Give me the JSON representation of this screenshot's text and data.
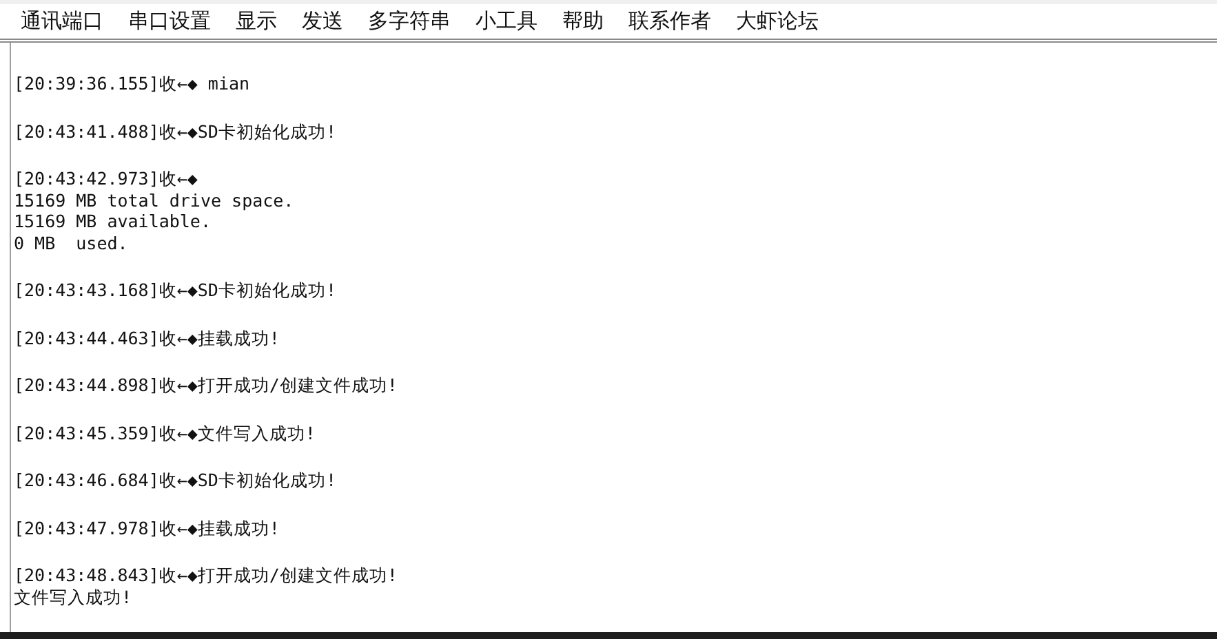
{
  "menu": [
    "通讯端口",
    "串口设置",
    "显示",
    "发送",
    "多字符串",
    "小工具",
    "帮助",
    "联系作者",
    "大虾论坛"
  ],
  "log": [
    {
      "lines": [
        "[20:39:36.155]收←◆ mian"
      ]
    },
    {
      "lines": [
        "[20:43:41.488]收←◆SD卡初始化成功!"
      ]
    },
    {
      "lines": [
        "[20:43:42.973]收←◆",
        "15169 MB total drive space.",
        "15169 MB available.",
        "0 MB  used."
      ]
    },
    {
      "lines": [
        "[20:43:43.168]收←◆SD卡初始化成功!"
      ]
    },
    {
      "lines": [
        "[20:43:44.463]收←◆挂载成功!"
      ]
    },
    {
      "lines": [
        "[20:43:44.898]收←◆打开成功/创建文件成功!"
      ]
    },
    {
      "lines": [
        "[20:43:45.359]收←◆文件写入成功!"
      ]
    },
    {
      "lines": [
        "[20:43:46.684]收←◆SD卡初始化成功!"
      ]
    },
    {
      "lines": [
        "[20:43:47.978]收←◆挂载成功!"
      ]
    },
    {
      "lines": [
        "[20:43:48.843]收←◆打开成功/创建文件成功!",
        "文件写入成功!"
      ]
    }
  ]
}
